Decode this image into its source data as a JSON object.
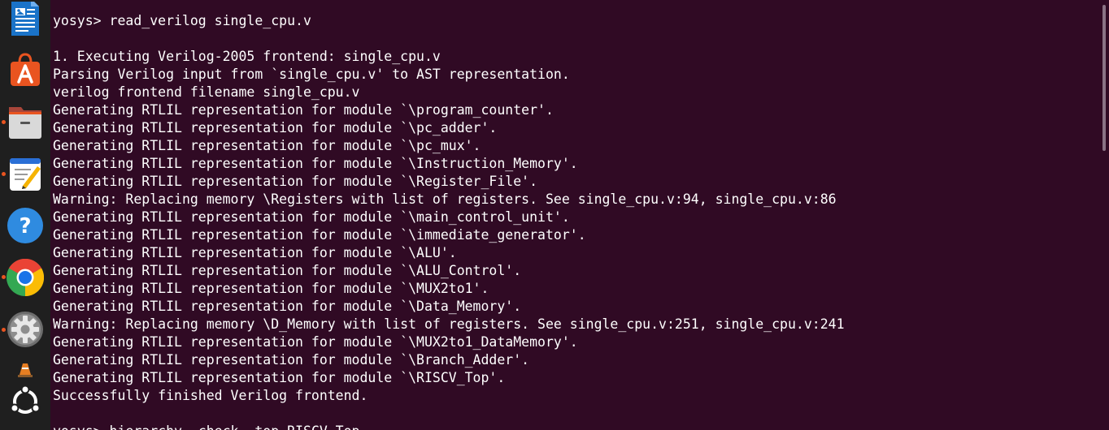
{
  "dock": {
    "items": [
      {
        "name": "libreoffice-writer",
        "icon": "document-icon",
        "running": false
      },
      {
        "name": "app-center",
        "icon": "shopping-bag-icon",
        "running": false
      },
      {
        "name": "files",
        "icon": "file-cabinet-icon",
        "running": true
      },
      {
        "name": "text-editor",
        "icon": "notepad-pencil-icon",
        "running": true
      },
      {
        "name": "help",
        "icon": "question-mark-icon",
        "running": false
      },
      {
        "name": "google-chrome",
        "icon": "chrome-icon",
        "running": true
      },
      {
        "name": "settings",
        "icon": "gear-icon",
        "running": true
      },
      {
        "name": "vlc",
        "icon": "traffic-cone-icon",
        "running": false
      },
      {
        "name": "show-apps",
        "icon": "ubuntu-logo-icon",
        "running": false
      }
    ],
    "accent": "#e95420"
  },
  "terminal": {
    "background": "#300a24",
    "foreground": "#ffffff",
    "lines": [
      "yosys> read_verilog single_cpu.v",
      "",
      "1. Executing Verilog-2005 frontend: single_cpu.v",
      "Parsing Verilog input from `single_cpu.v' to AST representation.",
      "verilog frontend filename single_cpu.v",
      "Generating RTLIL representation for module `\\program_counter'.",
      "Generating RTLIL representation for module `\\pc_adder'.",
      "Generating RTLIL representation for module `\\pc_mux'.",
      "Generating RTLIL representation for module `\\Instruction_Memory'.",
      "Generating RTLIL representation for module `\\Register_File'.",
      "Warning: Replacing memory \\Registers with list of registers. See single_cpu.v:94, single_cpu.v:86",
      "Generating RTLIL representation for module `\\main_control_unit'.",
      "Generating RTLIL representation for module `\\immediate_generator'.",
      "Generating RTLIL representation for module `\\ALU'.",
      "Generating RTLIL representation for module `\\ALU_Control'.",
      "Generating RTLIL representation for module `\\MUX2to1'.",
      "Generating RTLIL representation for module `\\Data_Memory'.",
      "Warning: Replacing memory \\D_Memory with list of registers. See single_cpu.v:251, single_cpu.v:241",
      "Generating RTLIL representation for module `\\MUX2to1_DataMemory'.",
      "Generating RTLIL representation for module `\\Branch_Adder'.",
      "Generating RTLIL representation for module `\\RISCV_Top'.",
      "Successfully finished Verilog frontend.",
      "",
      "yosys> hierarchy -check -top RISCV_Top"
    ]
  }
}
